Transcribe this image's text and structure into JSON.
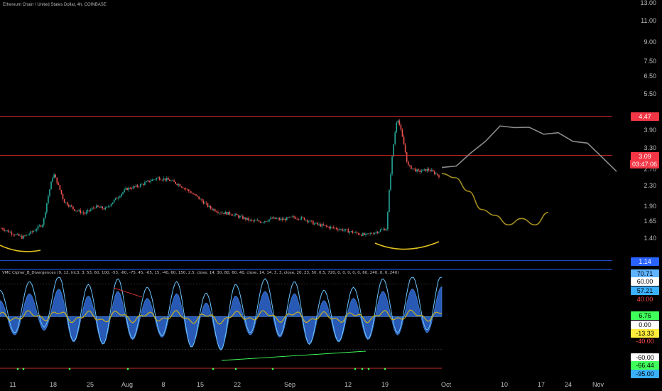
{
  "chart_data": [
    {
      "type": "line",
      "title": "Ethereum Chain / United States Dollar, 4h, COINBASE",
      "yscale": "log",
      "ylim": [
        1.1,
        13.0
      ],
      "y_ticks": [
        "13.00",
        "11.00",
        "9.00",
        "7.50",
        "6.50",
        "5.50",
        "3.90",
        "3.30",
        "2.70",
        "2.30",
        "1.90",
        "1.65",
        "1.40"
      ],
      "x_ticks": [
        "11",
        "18",
        "25",
        "Aug",
        "8",
        "15",
        "22",
        "Sep",
        "12",
        "19",
        "Oct",
        "10",
        "17",
        "24",
        "Nov"
      ],
      "series": [
        {
          "values": [
            1.55,
            1.48,
            1.42,
            1.5,
            1.62,
            2.6,
            2.0,
            1.85,
            1.78,
            1.9,
            1.86,
            2.05,
            2.25,
            2.3,
            2.4,
            2.5,
            2.45,
            2.35,
            2.2,
            2.05,
            1.88,
            1.8,
            1.78,
            1.72,
            1.66,
            1.65,
            1.7,
            1.68,
            1.72,
            1.7,
            1.62,
            1.58,
            1.55,
            1.52,
            1.48,
            1.45,
            1.5,
            1.55,
            4.47,
            2.8,
            2.65,
            2.7,
            2.55
          ]
        }
      ],
      "horizontal_levels": [
        {
          "value": 4.47,
          "label": "4.47",
          "color": "#ff3333"
        },
        {
          "value": 3.09,
          "label": "3.09",
          "sublabel": "03:47:06",
          "color": "#ff3333"
        },
        {
          "value": 1.14,
          "label": "1.14",
          "color": "#2962ff"
        }
      ],
      "projection_grey": [
        2.7,
        2.85,
        3.1,
        3.6,
        4.0,
        4.1,
        3.95,
        3.85,
        3.75,
        3.6,
        3.4,
        3.1,
        2.6
      ],
      "projection_yellow": [
        2.6,
        2.5,
        2.2,
        1.85,
        1.75,
        1.6,
        1.7,
        1.6,
        1.8
      ]
    },
    {
      "type": "line",
      "title": "VMC Cipher_B_Divergences (9, 12, hlc3, 3, 53, 60, 100, -53, -60, -75, 45, -65, 15, -40, 60, 150, 2.5, close, 14, 30, 80, 60, 40, close, 14, 14, 3, 3, close, 20, 23, 50, 0.5, 720, 0, 0, 0, 0, 0, 60, 240, 0, 0, 240)",
      "ylim": [
        -95,
        75
      ],
      "y_tags": [
        {
          "value": "70.71",
          "color": "#5fb3ff"
        },
        {
          "value": "60.00",
          "color": "#ffffff"
        },
        {
          "value": "57.21",
          "color": "#3ab0ff"
        },
        {
          "value": "40.00",
          "color": "#ff4d4d"
        },
        {
          "value": "6.76",
          "color": "#3fff5a"
        },
        {
          "value": "0.00",
          "color": "#ffffff"
        },
        {
          "value": "-13.33",
          "color": "#ffeb3b"
        },
        {
          "value": "-40.00",
          "color": "#ff4d4d"
        },
        {
          "value": "-60.00",
          "color": "#ffffff"
        },
        {
          "value": "-66.44",
          "color": "#3fff5a"
        },
        {
          "value": "-95.00",
          "color": "#3ab0ff"
        }
      ],
      "wave_values": [
        35,
        -40,
        50,
        -30,
        60,
        -55,
        45,
        -60,
        55,
        -50,
        40,
        -45,
        50,
        -65,
        30,
        -70,
        45,
        -40,
        55,
        -45,
        50,
        -60,
        35,
        -55,
        40,
        -50,
        55,
        -40,
        60,
        -35,
        65
      ]
    }
  ]
}
